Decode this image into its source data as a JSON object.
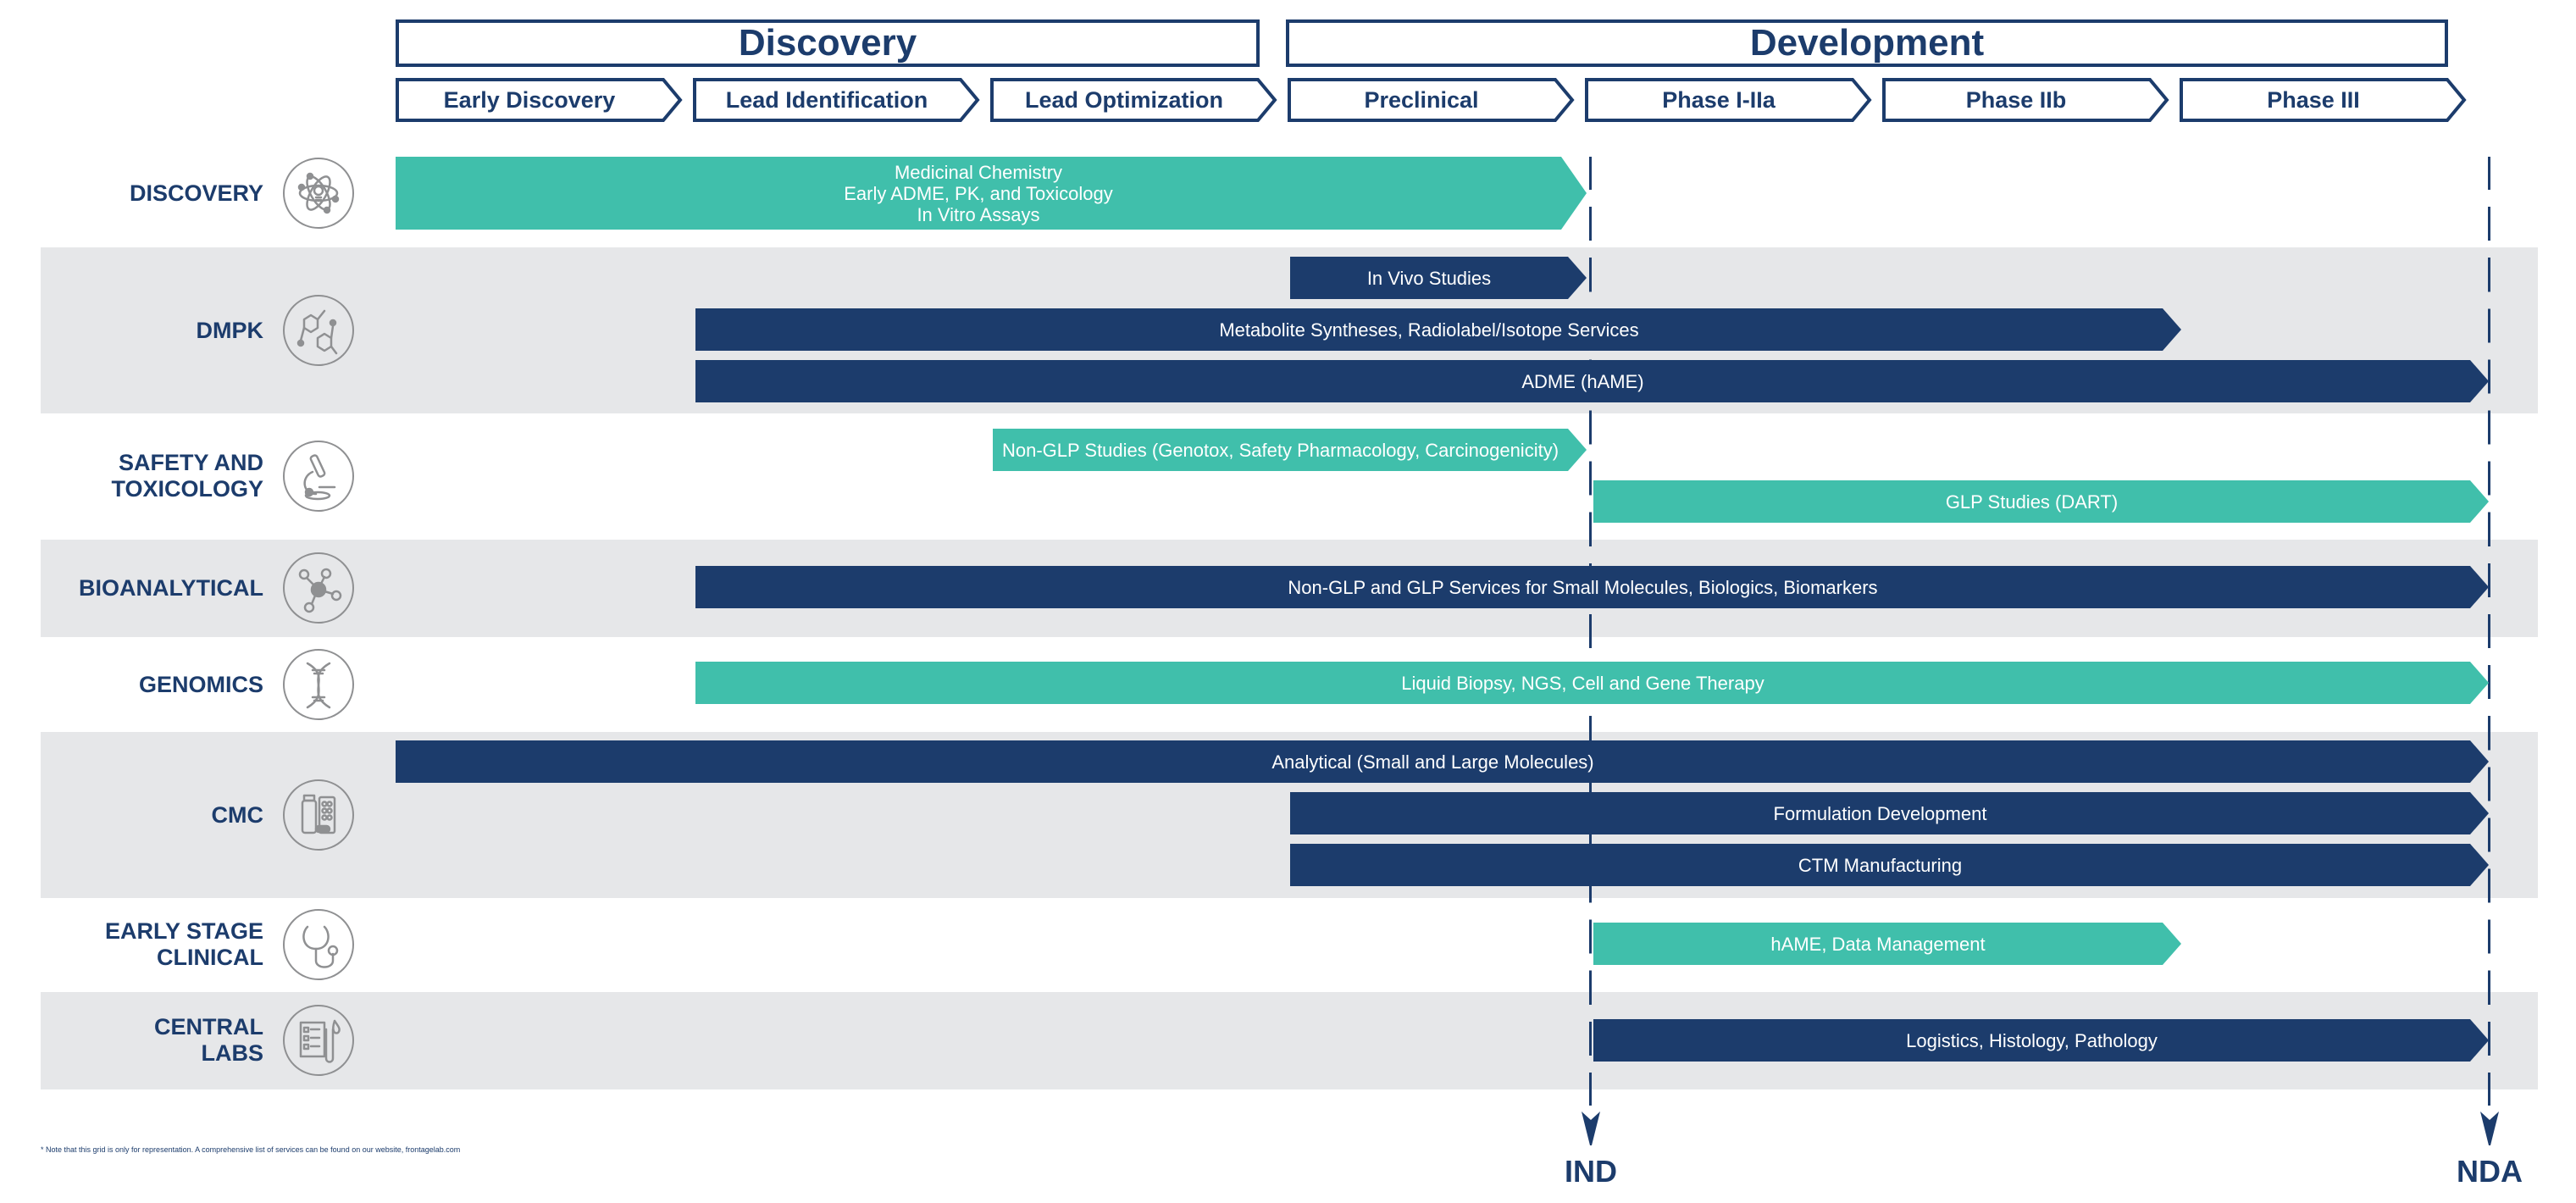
{
  "colors": {
    "navy": "#1c3c6c",
    "teal": "#40bfab",
    "band": "#e6e7e9",
    "icon": "#8f9092"
  },
  "stages": [
    {
      "label": "Discovery",
      "phase_span": [
        0,
        3
      ]
    },
    {
      "label": "Development",
      "phase_span": [
        3,
        7
      ]
    }
  ],
  "phases": [
    "Early Discovery",
    "Lead Identification",
    "Lead Optimization",
    "Preclinical",
    "Phase I-IIa",
    "Phase IIb",
    "Phase III"
  ],
  "milestones": [
    {
      "label": "IND",
      "position_phase": 4.0
    },
    {
      "label": "NDA",
      "position_phase": 7.0
    }
  ],
  "rows": [
    {
      "label": "DISCOVERY",
      "icon": "atom-lightbulb-icon",
      "shaded": false,
      "bars": [
        {
          "text": "Medicinal Chemistry\nEarly ADME, PK, and Toxicology\nIn Vitro Assays",
          "color": "teal",
          "start": 0.0,
          "end": 4.0
        }
      ]
    },
    {
      "label": "DMPK",
      "icon": "molecule-structure-icon",
      "shaded": true,
      "bars": [
        {
          "text": "In Vivo Studies",
          "color": "navy",
          "start": 3.0,
          "end": 4.0
        },
        {
          "text": "Metabolite Syntheses, Radiolabel/Isotope Services",
          "color": "navy",
          "start": 1.0,
          "end": 6.0
        },
        {
          "text": "ADME (hAME)",
          "color": "navy",
          "start": 1.0,
          "end": 7.0
        }
      ]
    },
    {
      "label": "SAFETY AND\nTOXICOLOGY",
      "icon": "microscope-icon",
      "shaded": false,
      "bars": [
        {
          "text": "Non-GLP Studies (Genotox, Safety Pharmacology, Carcinogenicity)",
          "color": "teal",
          "start": 2.0,
          "end": 4.0
        },
        {
          "text": "GLP Studies (DART)",
          "color": "teal",
          "start": 4.0,
          "end": 7.0
        }
      ]
    },
    {
      "label": "BIOANALYTICAL",
      "icon": "network-nodes-icon",
      "shaded": true,
      "bars": [
        {
          "text": "Non-GLP and GLP Services for Small Molecules, Biologics, Biomarkers",
          "color": "navy",
          "start": 1.0,
          "end": 7.0
        }
      ]
    },
    {
      "label": "GENOMICS",
      "icon": "dna-helix-icon",
      "shaded": false,
      "bars": [
        {
          "text": "Liquid Biopsy, NGS, Cell and Gene Therapy",
          "color": "teal",
          "start": 1.0,
          "end": 7.0
        }
      ]
    },
    {
      "label": "CMC",
      "icon": "medicine-bottle-pills-icon",
      "shaded": true,
      "bars": [
        {
          "text": "Analytical (Small and Large Molecules)",
          "color": "navy",
          "start": 0.0,
          "end": 7.0
        },
        {
          "text": "Formulation Development",
          "color": "navy",
          "start": 3.0,
          "end": 7.0
        },
        {
          "text": "CTM Manufacturing",
          "color": "navy",
          "start": 3.0,
          "end": 7.0
        }
      ]
    },
    {
      "label": "EARLY STAGE\nCLINICAL",
      "icon": "stethoscope-icon",
      "shaded": false,
      "bars": [
        {
          "text": "hAME, Data Management",
          "color": "teal",
          "start": 4.0,
          "end": 6.0
        }
      ]
    },
    {
      "label": "CENTRAL\nLABS",
      "icon": "checklist-test-tube-icon",
      "shaded": true,
      "bars": [
        {
          "text": "Logistics, Histology, Pathology",
          "color": "navy",
          "start": 4.0,
          "end": 7.0
        }
      ]
    }
  ],
  "footnote": "* Note that this grid is only for representation. A comprehensive list of services can be found on our website, frontagelab.com"
}
